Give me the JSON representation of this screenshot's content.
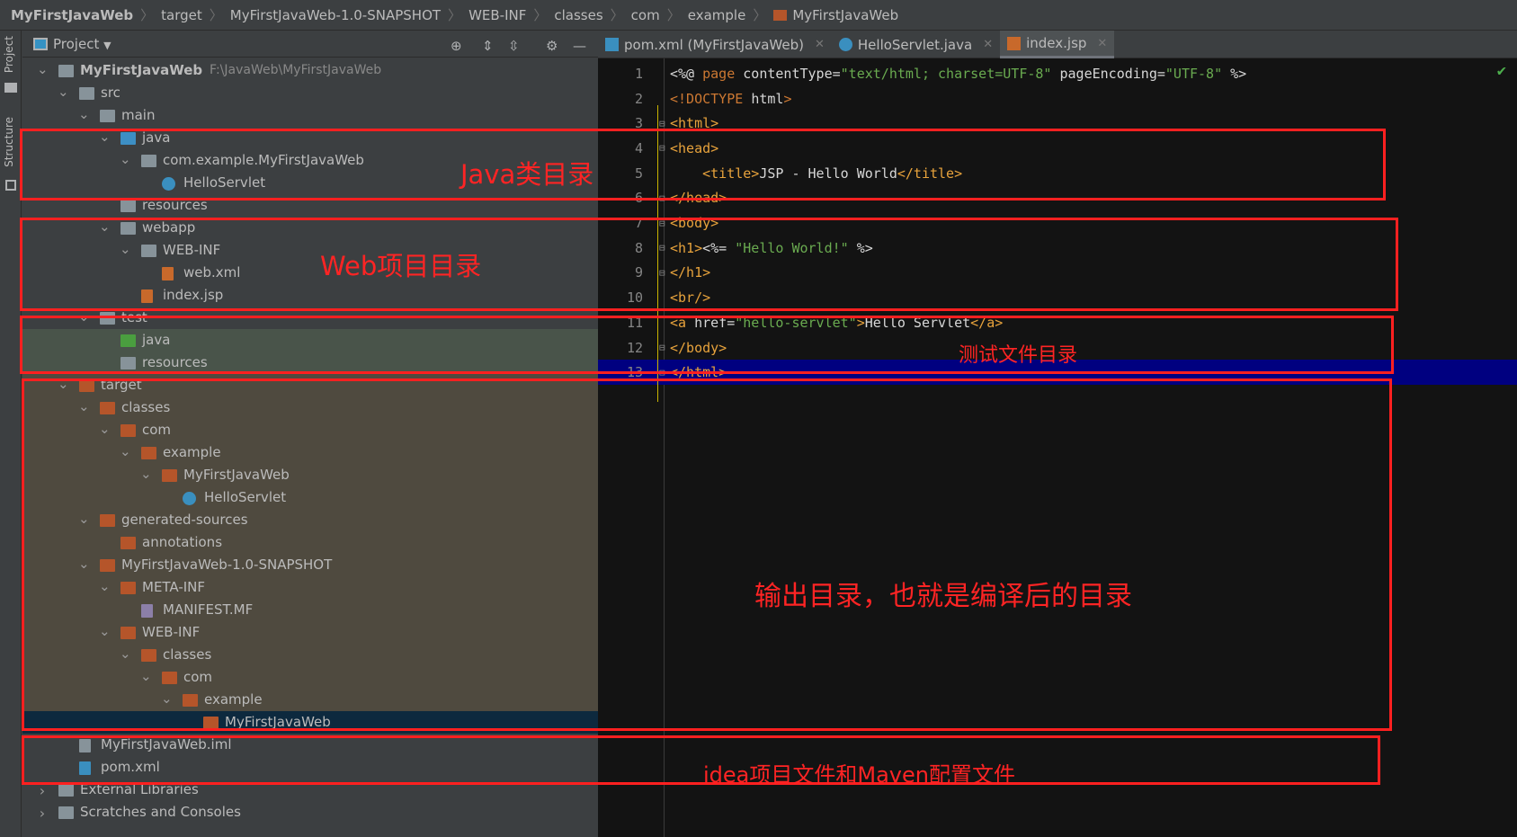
{
  "breadcrumb": [
    "MyFirstJavaWeb",
    "target",
    "MyFirstJavaWeb-1.0-SNAPSHOT",
    "WEB-INF",
    "classes",
    "com",
    "example",
    "MyFirstJavaWeb"
  ],
  "side_tabs": {
    "project": "Project",
    "structure": "Structure"
  },
  "project_panel": {
    "title": "Project",
    "icons": [
      "locate-icon",
      "expand-all-icon",
      "collapse-all-icon",
      "gear-icon",
      "minimize-icon"
    ]
  },
  "tree": [
    {
      "label": "MyFirstJavaWeb",
      "sub": "F:\\JavaWeb\\MyFirstJavaWeb",
      "level": 0,
      "exp": "open",
      "icon": "module",
      "bold": true
    },
    {
      "label": "src",
      "level": 1,
      "exp": "open",
      "icon": "folder"
    },
    {
      "label": "main",
      "level": 2,
      "exp": "open",
      "icon": "folder"
    },
    {
      "label": "java",
      "level": 3,
      "exp": "open",
      "icon": "source-folder"
    },
    {
      "label": "com.example.MyFirstJavaWeb",
      "level": 4,
      "exp": "open",
      "icon": "package"
    },
    {
      "label": "HelloServlet",
      "level": 5,
      "icon": "class"
    },
    {
      "label": "resources",
      "level": 3,
      "icon": "resources-folder"
    },
    {
      "label": "webapp",
      "level": 3,
      "exp": "open",
      "icon": "web-folder"
    },
    {
      "label": "WEB-INF",
      "level": 4,
      "exp": "open",
      "icon": "folder"
    },
    {
      "label": "web.xml",
      "level": 5,
      "icon": "xml-file"
    },
    {
      "label": "index.jsp",
      "level": 4,
      "icon": "jsp-file"
    },
    {
      "label": "test",
      "level": 2,
      "exp": "open",
      "icon": "folder"
    },
    {
      "label": "java",
      "level": 3,
      "icon": "test-folder",
      "band": "test"
    },
    {
      "label": "resources",
      "level": 3,
      "icon": "test-resources-folder",
      "band": "test"
    },
    {
      "label": "target",
      "level": 1,
      "exp": "open",
      "icon": "excluded-folder",
      "band": "target"
    },
    {
      "label": "classes",
      "level": 2,
      "exp": "open",
      "icon": "excluded-folder",
      "band": "target"
    },
    {
      "label": "com",
      "level": 3,
      "exp": "open",
      "icon": "excluded-folder",
      "band": "target"
    },
    {
      "label": "example",
      "level": 4,
      "exp": "open",
      "icon": "excluded-folder",
      "band": "target"
    },
    {
      "label": "MyFirstJavaWeb",
      "level": 5,
      "exp": "open",
      "icon": "excluded-folder",
      "band": "target"
    },
    {
      "label": "HelloServlet",
      "level": 6,
      "icon": "class",
      "band": "target"
    },
    {
      "label": "generated-sources",
      "level": 2,
      "exp": "open",
      "icon": "excluded-folder",
      "band": "target"
    },
    {
      "label": "annotations",
      "level": 3,
      "icon": "excluded-folder",
      "band": "target"
    },
    {
      "label": "MyFirstJavaWeb-1.0-SNAPSHOT",
      "level": 2,
      "exp": "open",
      "icon": "excluded-folder",
      "band": "target"
    },
    {
      "label": "META-INF",
      "level": 3,
      "exp": "open",
      "icon": "excluded-folder",
      "band": "target"
    },
    {
      "label": "MANIFEST.MF",
      "level": 4,
      "icon": "manifest-file",
      "band": "target"
    },
    {
      "label": "WEB-INF",
      "level": 3,
      "exp": "open",
      "icon": "excluded-folder",
      "band": "target"
    },
    {
      "label": "classes",
      "level": 4,
      "exp": "open",
      "icon": "excluded-folder",
      "band": "target"
    },
    {
      "label": "com",
      "level": 5,
      "exp": "open",
      "icon": "excluded-folder",
      "band": "target"
    },
    {
      "label": "example",
      "level": 6,
      "exp": "open",
      "icon": "excluded-folder",
      "band": "target"
    },
    {
      "label": "MyFirstJavaWeb",
      "level": 7,
      "icon": "excluded-folder",
      "band": "selected"
    },
    {
      "label": "MyFirstJavaWeb.iml",
      "level": 1,
      "icon": "iml-file"
    },
    {
      "label": "pom.xml",
      "level": 1,
      "icon": "maven-file"
    },
    {
      "label": "External Libraries",
      "level": 0,
      "exp": "closed",
      "icon": "libraries"
    },
    {
      "label": "Scratches and Consoles",
      "level": 0,
      "exp": "closed",
      "icon": "scratches"
    }
  ],
  "tabs": [
    {
      "label": "pom.xml (MyFirstJavaWeb)",
      "icon": "maven-icon",
      "active": false
    },
    {
      "label": "HelloServlet.java",
      "icon": "class-icon",
      "active": false
    },
    {
      "label": "index.jsp",
      "icon": "jsp-icon",
      "active": true
    }
  ],
  "code": [
    [
      [
        "<%@ ",
        "tx"
      ],
      [
        "page ",
        "kw"
      ],
      [
        "contentType=",
        "tx"
      ],
      [
        "\"text/html; charset=UTF-8\"",
        "st"
      ],
      [
        " pageEncoding=",
        "tx"
      ],
      [
        "\"UTF-8\"",
        "st"
      ],
      [
        " %>",
        "tx"
      ]
    ],
    [
      [
        "<!DOCTYPE ",
        "kw"
      ],
      [
        "html",
        "tx"
      ],
      [
        ">",
        "kw"
      ]
    ],
    [
      [
        "<html>",
        "tg"
      ]
    ],
    [
      [
        "<head>",
        "tg"
      ]
    ],
    [
      [
        "    <title>",
        "tg"
      ],
      [
        "JSP - Hello World",
        "tx"
      ],
      [
        "</title>",
        "tg"
      ]
    ],
    [
      [
        "</head>",
        "tg"
      ]
    ],
    [
      [
        "<body>",
        "tg"
      ]
    ],
    [
      [
        "<h1>",
        "tg"
      ],
      [
        "<%= ",
        "tx"
      ],
      [
        "\"Hello World!\"",
        "st"
      ],
      [
        " %>",
        "tx"
      ]
    ],
    [
      [
        "</h1>",
        "tg"
      ]
    ],
    [
      [
        "<br/>",
        "tg"
      ]
    ],
    [
      [
        "<a ",
        "tg"
      ],
      [
        "href=",
        "tx"
      ],
      [
        "\"hello-servlet\"",
        "st"
      ],
      [
        ">",
        "tg"
      ],
      [
        "Hello Servlet",
        "tx"
      ],
      [
        "</a>",
        "tg"
      ]
    ],
    [
      [
        "</body>",
        "tg"
      ]
    ],
    [
      [
        "</html>",
        "tg"
      ]
    ]
  ],
  "annotations": {
    "java": "Java类目录",
    "web": "Web项目目录",
    "test": "测试文件目录",
    "output": "输出目录，也就是编译后的目录",
    "idea": "idea项目文件和Maven配置文件"
  },
  "colors": {
    "annotation": "#ff2020",
    "current_line": "#000080",
    "test_band": "#49544a",
    "target_band": "#4f4a3f",
    "selected": "#0d293e"
  }
}
